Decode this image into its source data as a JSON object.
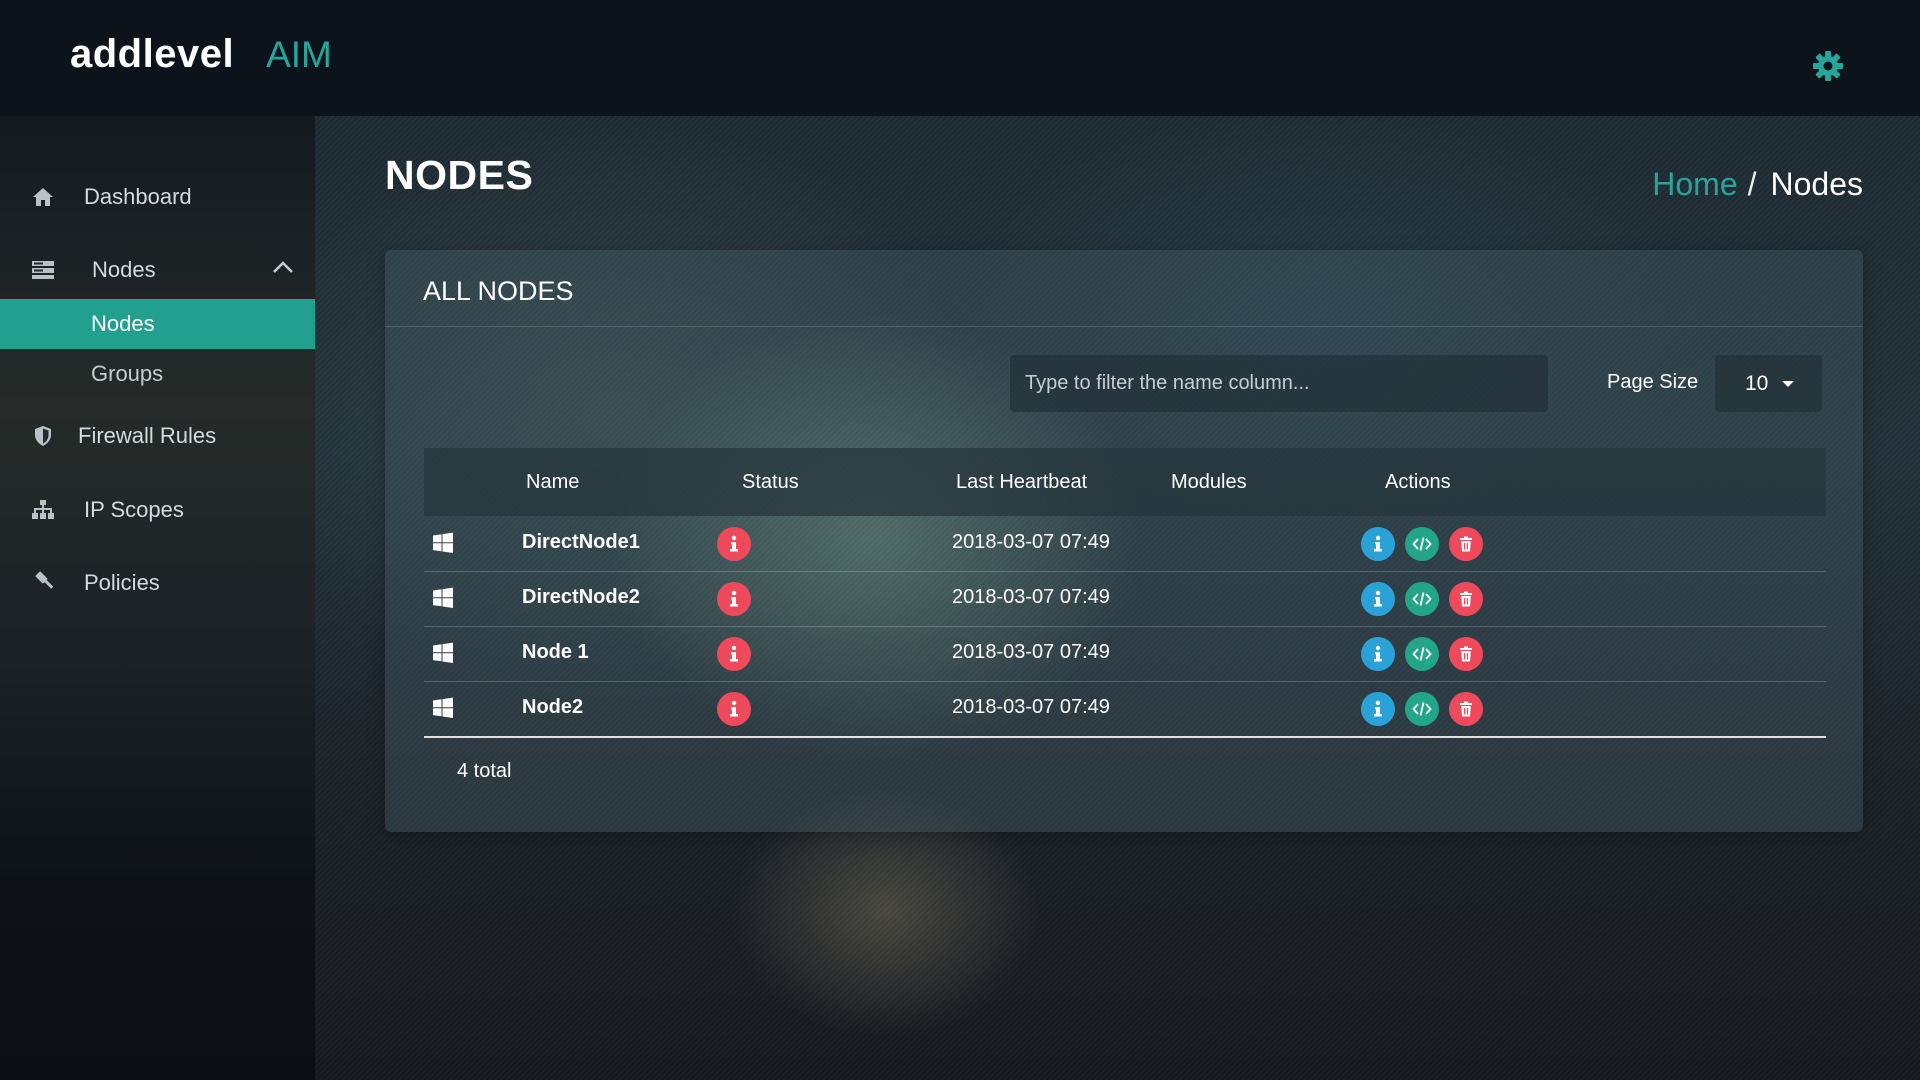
{
  "app": {
    "brand_name": "addlevel",
    "product_name": "AIM"
  },
  "icons": {
    "settings": "gear-icon",
    "windows": "windows-icon",
    "status": "info-icon",
    "info_action": "info-icon",
    "code_action": "code-icon",
    "delete_action": "trash-icon"
  },
  "colors": {
    "accent": "#26a69a",
    "danger": "#ee4a5c",
    "info": "#2aa2d8",
    "success": "#23a58a"
  },
  "sidebar": {
    "items": [
      {
        "label": "Dashboard",
        "icon": "home-icon"
      },
      {
        "label": "Nodes",
        "icon": "server-icon",
        "expanded": true,
        "children": [
          {
            "label": "Nodes",
            "active": true
          },
          {
            "label": "Groups",
            "active": false
          }
        ]
      },
      {
        "label": "Firewall Rules",
        "icon": "shield-icon"
      },
      {
        "label": "IP Scopes",
        "icon": "sitemap-icon"
      },
      {
        "label": "Policies",
        "icon": "gavel-icon"
      }
    ]
  },
  "page": {
    "title": "NODES",
    "breadcrumb": {
      "home": "Home",
      "separator": "/",
      "current": "Nodes"
    }
  },
  "card": {
    "title": "ALL NODES",
    "filter": {
      "placeholder": "Type to filter the name column...",
      "value": ""
    },
    "page_size": {
      "label": "Page Size",
      "value": "10"
    },
    "columns": [
      "Name",
      "Status",
      "Last Heartbeat",
      "Modules",
      "Actions"
    ],
    "rows": [
      {
        "os": "windows",
        "name": "DirectNode1",
        "status": "error",
        "last_heartbeat": "2018-03-07 07:49",
        "modules": ""
      },
      {
        "os": "windows",
        "name": "DirectNode2",
        "status": "error",
        "last_heartbeat": "2018-03-07 07:49",
        "modules": ""
      },
      {
        "os": "windows",
        "name": "Node 1",
        "status": "error",
        "last_heartbeat": "2018-03-07 07:49",
        "modules": ""
      },
      {
        "os": "windows",
        "name": "Node2",
        "status": "error",
        "last_heartbeat": "2018-03-07 07:49",
        "modules": ""
      }
    ],
    "total": "4 total"
  }
}
